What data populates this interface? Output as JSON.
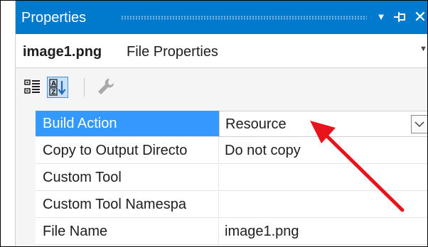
{
  "panel": {
    "title": "Properties",
    "dropdown_icon": "triangle-down",
    "pin_icon": "auto-hide-pin",
    "close_icon": "close-x"
  },
  "object": {
    "name": "image1.png",
    "type": "File Properties"
  },
  "toolbar": {
    "buttons": [
      {
        "icon": "categorized-icon",
        "active": false
      },
      {
        "icon": "alphabetical-icon",
        "active": true
      },
      {
        "icon": "property-pages-icon",
        "active": false
      }
    ]
  },
  "grid": {
    "rows": [
      {
        "name": "Build Action",
        "value": "Resource",
        "selected": true
      },
      {
        "name": "Copy to Output Directo",
        "value": "Do not copy",
        "selected": false
      },
      {
        "name": "Custom Tool",
        "value": "",
        "selected": false
      },
      {
        "name": "Custom Tool Namespa",
        "value": "",
        "selected": false
      },
      {
        "name": "File Name",
        "value": "image1.png",
        "selected": false
      }
    ]
  },
  "annotation": {
    "arrow_color": "#e8141b"
  },
  "colors": {
    "title_bar": "#007acc",
    "selection": "#3399ff",
    "toolbar_active": "#c9e0f7"
  }
}
